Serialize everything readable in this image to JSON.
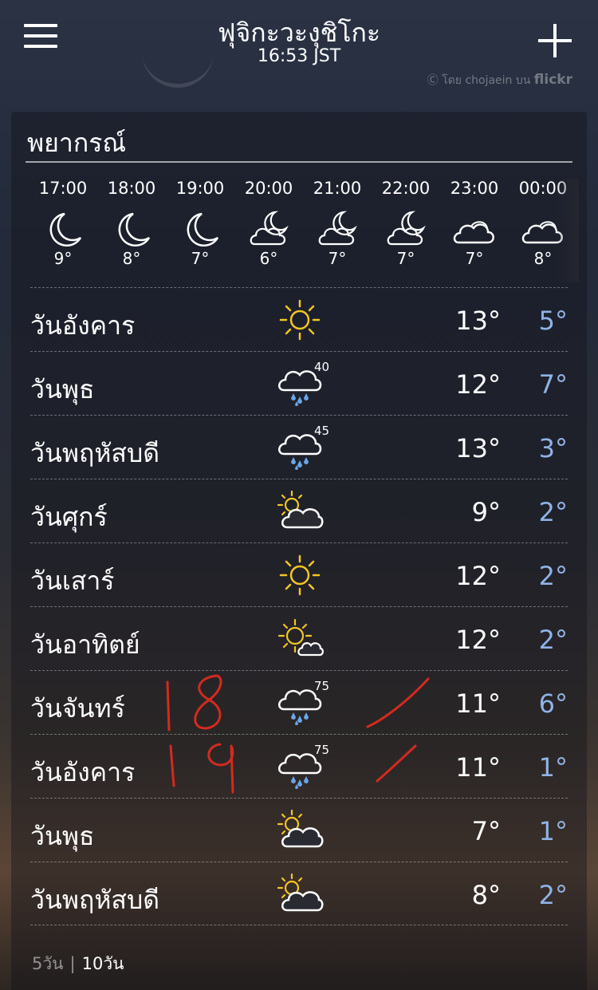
{
  "header": {
    "city": "ฟุจิกะวะงุชิโกะ",
    "time": "16:53 JST",
    "photo_credit": "โดย chojaein บน",
    "photo_source": "flickr"
  },
  "forecast": {
    "title": "พยากรณ์",
    "hourly": [
      {
        "time": "17:00",
        "icon": "moon-icon",
        "temp": "9°"
      },
      {
        "time": "18:00",
        "icon": "moon-icon",
        "temp": "8°"
      },
      {
        "time": "19:00",
        "icon": "moon-icon",
        "temp": "7°"
      },
      {
        "time": "20:00",
        "icon": "partly-cloudy-night-icon",
        "temp": "6°"
      },
      {
        "time": "21:00",
        "icon": "partly-cloudy-night-icon",
        "temp": "7°"
      },
      {
        "time": "22:00",
        "icon": "partly-cloudy-night-icon",
        "temp": "7°"
      },
      {
        "time": "23:00",
        "icon": "cloudy-icon",
        "temp": "7°"
      },
      {
        "time": "00:00",
        "icon": "cloudy-icon",
        "temp": "8°"
      }
    ],
    "daily": [
      {
        "day": "วันอังคาร",
        "icon": "sunny-icon",
        "precip": "",
        "high": "13°",
        "low": "5°"
      },
      {
        "day": "วันพุธ",
        "icon": "rain-icon",
        "precip": "40",
        "high": "12°",
        "low": "7°"
      },
      {
        "day": "วันพฤหัสบดี",
        "icon": "rain-icon",
        "precip": "45",
        "high": "13°",
        "low": "3°"
      },
      {
        "day": "วันศุกร์",
        "icon": "partly-cloudy-icon",
        "precip": "",
        "high": "9°",
        "low": "2°"
      },
      {
        "day": "วันเสาร์",
        "icon": "sunny-icon",
        "precip": "",
        "high": "12°",
        "low": "2°"
      },
      {
        "day": "วันอาทิตย์",
        "icon": "mostly-sunny-icon",
        "precip": "",
        "high": "12°",
        "low": "2°"
      },
      {
        "day": "วันจันทร์",
        "icon": "rain-icon",
        "precip": "75",
        "high": "11°",
        "low": "6°"
      },
      {
        "day": "วันอังคาร",
        "icon": "rain-icon",
        "precip": "75",
        "high": "11°",
        "low": "1°"
      },
      {
        "day": "วันพุธ",
        "icon": "partly-cloudy-icon",
        "precip": "",
        "high": "7°",
        "low": "1°"
      },
      {
        "day": "วันพฤหัสบดี",
        "icon": "partly-cloudy-icon",
        "precip": "",
        "high": "8°",
        "low": "2°"
      }
    ],
    "range_toggle": {
      "five_day": "5วัน",
      "ten_day": "10วัน",
      "selected": "10วัน"
    }
  },
  "annotations": {
    "handwritten_1": "18",
    "handwritten_2": "19",
    "color": "#d42a1e"
  },
  "colors": {
    "low_temp": "#8fb3e6",
    "sun": "#f3c623"
  }
}
